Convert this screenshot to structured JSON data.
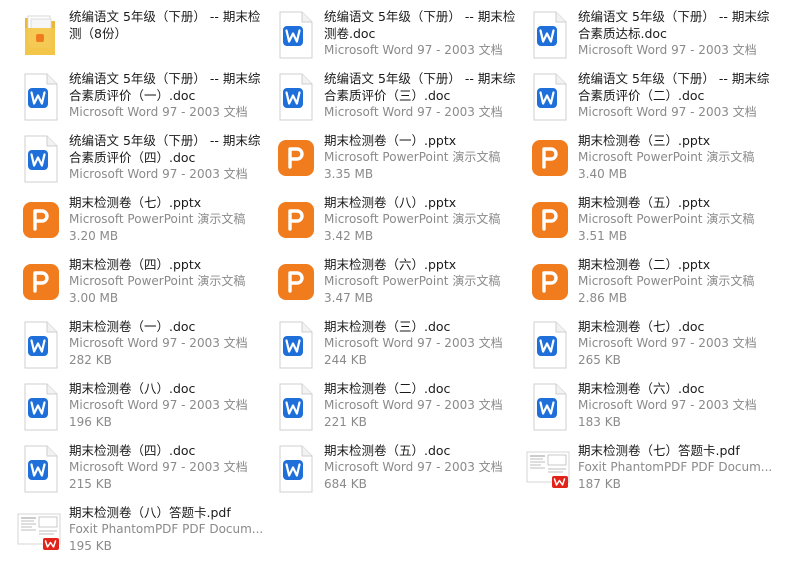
{
  "items": [
    {
      "icon": "folder-icon",
      "name": "统编语文 5年级（下册） -- 期末检测（8份）",
      "type": "",
      "size": ""
    },
    {
      "icon": "word-doc-icon",
      "name": "统编语文 5年级（下册） -- 期末检测卷.doc",
      "type": "Microsoft Word 97 - 2003 文档",
      "size": ""
    },
    {
      "icon": "word-doc-icon",
      "name": "统编语文 5年级（下册） -- 期末综合素质达标.doc",
      "type": "Microsoft Word 97 - 2003 文档",
      "size": ""
    },
    {
      "icon": "word-doc-icon",
      "name": "统编语文 5年级（下册） -- 期末综合素质评价（一）.doc",
      "type": "Microsoft Word 97 - 2003 文档",
      "size": ""
    },
    {
      "icon": "word-doc-icon",
      "name": "统编语文 5年级（下册） -- 期末综合素质评价（三）.doc",
      "type": "Microsoft Word 97 - 2003 文档",
      "size": ""
    },
    {
      "icon": "word-doc-icon",
      "name": "统编语文 5年级（下册） -- 期末综合素质评价（二）.doc",
      "type": "Microsoft Word 97 - 2003 文档",
      "size": ""
    },
    {
      "icon": "word-doc-icon",
      "name": "统编语文 5年级（下册） -- 期末综合素质评价（四）.doc",
      "type": "Microsoft Word 97 - 2003 文档",
      "size": ""
    },
    {
      "icon": "powerpoint-icon",
      "name": "期末检测卷（一）.pptx",
      "type": "Microsoft PowerPoint 演示文稿",
      "size": "3.35 MB"
    },
    {
      "icon": "powerpoint-icon",
      "name": "期末检测卷（三）.pptx",
      "type": "Microsoft PowerPoint 演示文稿",
      "size": "3.40 MB"
    },
    {
      "icon": "powerpoint-icon",
      "name": "期末检测卷（七）.pptx",
      "type": "Microsoft PowerPoint 演示文稿",
      "size": "3.20 MB"
    },
    {
      "icon": "powerpoint-icon",
      "name": "期末检测卷（八）.pptx",
      "type": "Microsoft PowerPoint 演示文稿",
      "size": "3.42 MB"
    },
    {
      "icon": "powerpoint-icon",
      "name": "期末检测卷（五）.pptx",
      "type": "Microsoft PowerPoint 演示文稿",
      "size": "3.51 MB"
    },
    {
      "icon": "powerpoint-icon",
      "name": "期末检测卷（四）.pptx",
      "type": "Microsoft PowerPoint 演示文稿",
      "size": "3.00 MB"
    },
    {
      "icon": "powerpoint-icon",
      "name": "期末检测卷（六）.pptx",
      "type": "Microsoft PowerPoint 演示文稿",
      "size": "3.47 MB"
    },
    {
      "icon": "powerpoint-icon",
      "name": "期末检测卷（二）.pptx",
      "type": "Microsoft PowerPoint 演示文稿",
      "size": "2.86 MB"
    },
    {
      "icon": "word-doc-icon",
      "name": "期末检测卷（一）.doc",
      "type": "Microsoft Word 97 - 2003 文档",
      "size": "282 KB"
    },
    {
      "icon": "word-doc-icon",
      "name": "期末检测卷（三）.doc",
      "type": "Microsoft Word 97 - 2003 文档",
      "size": "244 KB"
    },
    {
      "icon": "word-doc-icon",
      "name": "期末检测卷（七）.doc",
      "type": "Microsoft Word 97 - 2003 文档",
      "size": "265 KB"
    },
    {
      "icon": "word-doc-icon",
      "name": "期末检测卷（八）.doc",
      "type": "Microsoft Word 97 - 2003 文档",
      "size": "196 KB"
    },
    {
      "icon": "word-doc-icon",
      "name": "期末检测卷（二）.doc",
      "type": "Microsoft Word 97 - 2003 文档",
      "size": "221 KB"
    },
    {
      "icon": "word-doc-icon",
      "name": "期末检测卷（六）.doc",
      "type": "Microsoft Word 97 - 2003 文档",
      "size": "183 KB"
    },
    {
      "icon": "word-doc-icon",
      "name": "期末检测卷（四）.doc",
      "type": "Microsoft Word 97 - 2003 文档",
      "size": "215 KB"
    },
    {
      "icon": "word-doc-icon",
      "name": "期末检测卷（五）.doc",
      "type": "Microsoft Word 97 - 2003 文档",
      "size": "684 KB"
    },
    {
      "icon": "pdf-thumbnail-icon",
      "name": "期末检测卷（七）答题卡.pdf",
      "type": "Foxit PhantomPDF PDF Docum...",
      "size": "187 KB"
    },
    {
      "icon": "pdf-thumbnail-icon",
      "name": "期末检测卷（八）答题卡.pdf",
      "type": "Foxit PhantomPDF PDF Docum...",
      "size": "195 KB"
    }
  ],
  "colors": {
    "word_blue": "#1e6fd9",
    "ppt_orange": "#f07c1e",
    "wps_red": "#e2231a",
    "folder_yellow": "#f3c64b"
  }
}
